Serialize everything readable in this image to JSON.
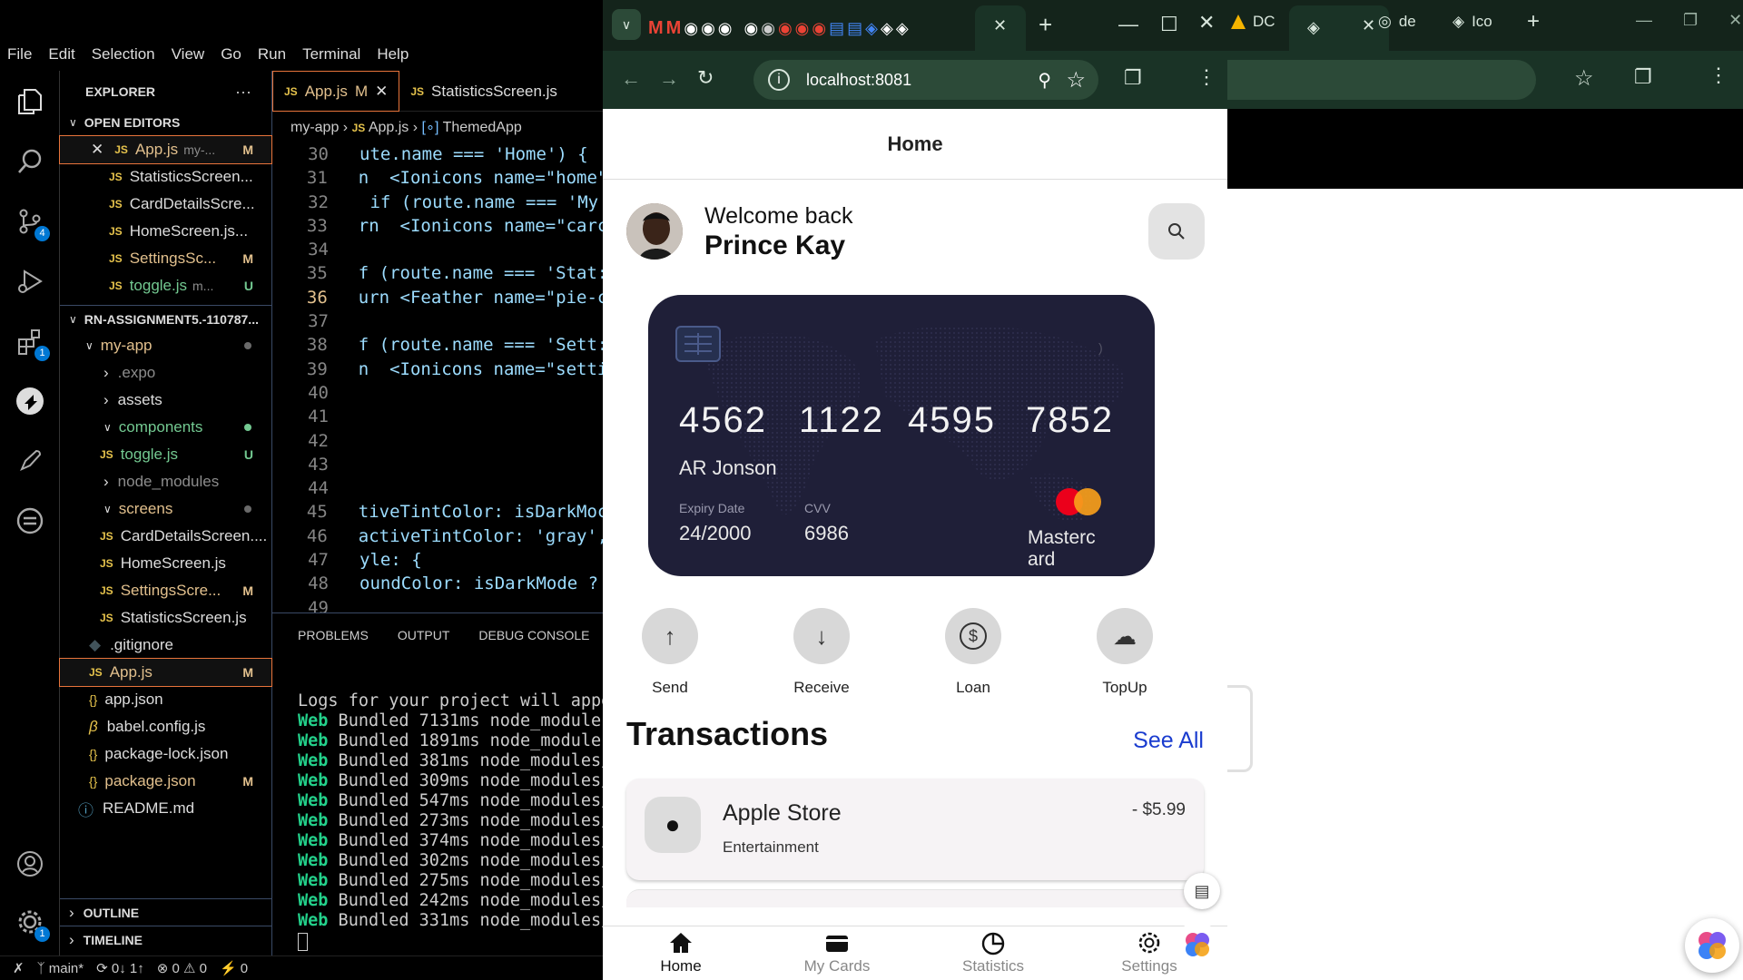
{
  "vscode": {
    "menu": [
      "File",
      "Edit",
      "Selection",
      "View",
      "Go",
      "Run",
      "Terminal",
      "Help"
    ],
    "explorer_title": "EXPLORER",
    "open_editors_title": "OPEN EDITORS",
    "open_editors": [
      {
        "name": "App.js",
        "desc": "my-...",
        "mark": "M"
      },
      {
        "name": "StatisticsScreen...",
        "mark": ""
      },
      {
        "name": "CardDetailsScre...",
        "mark": ""
      },
      {
        "name": "HomeScreen.js...",
        "mark": ""
      },
      {
        "name": "SettingsSc...",
        "mark": "M"
      },
      {
        "name": "toggle.js",
        "desc": "m...",
        "mark": "U"
      }
    ],
    "project_title": "RN-ASSIGNMENT5.-110787...",
    "tree": {
      "my_app": "my-app",
      "expo": ".expo",
      "assets": "assets",
      "components": "components",
      "toggle": "toggle.js",
      "toggle_mark": "U",
      "node_modules": "node_modules",
      "screens": "screens",
      "card_details": "CardDetailsScreen....",
      "home_screen": "HomeScreen.js",
      "settings_screen": "SettingsScre...",
      "settings_mark": "M",
      "statistics_screen": "StatisticsScreen.js",
      "gitignore": ".gitignore",
      "app_js": "App.js",
      "app_js_mark": "M",
      "app_json": "app.json",
      "babel": "babel.config.js",
      "package_lock": "package-lock.json",
      "package_json": "package.json",
      "package_json_mark": "M",
      "readme": "README.md"
    },
    "outline": "OUTLINE",
    "timeline": "TIMELINE",
    "tabs": [
      {
        "name": "App.js",
        "mark": "M"
      },
      {
        "name": "StatisticsScreen.js"
      }
    ],
    "breadcrumb": [
      "my-app",
      "App.js",
      "ThemedApp"
    ],
    "line_numbers": [
      "30",
      "31",
      "32",
      "33",
      "34",
      "35",
      "36",
      "37",
      "38",
      "39",
      "40",
      "41",
      "42",
      "43",
      "44",
      "45",
      "46",
      "47",
      "48",
      "49"
    ],
    "code_lines": [
      "ute.name === 'Home') {",
      "n  <Ionicons name=\"home\"",
      " if (route.name === 'My",
      "rn  <Ionicons name=\"carc",
      "",
      "f (route.name === 'Stat:",
      "urn <Feather name=\"pie-c",
      "",
      "f (route.name === 'Sett:",
      "n  <Ionicons name=\"setti",
      "",
      "",
      "",
      "",
      "",
      "tiveTintColor: isDarkMoc",
      "activeTintColor: 'gray',",
      "yle: {",
      "oundColor: isDarkMode ?",
      ""
    ],
    "panel_tabs": [
      "PROBLEMS",
      "OUTPUT",
      "DEBUG CONSOLE"
    ],
    "terminal_first": "Logs for your project will appe",
    "terminal_bundles": [
      {
        "label": "Web",
        "text": " Bundled 7131ms node_modules"
      },
      {
        "label": "Web",
        "text": " Bundled 1891ms node_modules"
      },
      {
        "label": "Web",
        "text": " Bundled 381ms node_modules/"
      },
      {
        "label": "Web",
        "text": " Bundled 309ms node_modules/"
      },
      {
        "label": "Web",
        "text": " Bundled 547ms node_modules/"
      },
      {
        "label": "Web",
        "text": " Bundled 273ms node_modules/"
      },
      {
        "label": "Web",
        "text": " Bundled 374ms node_modules/"
      },
      {
        "label": "Web",
        "text": " Bundled 302ms node_modules/"
      },
      {
        "label": "Web",
        "text": " Bundled 275ms node_modules/"
      },
      {
        "label": "Web",
        "text": " Bundled 242ms node_modules/"
      },
      {
        "label": "Web",
        "text": " Bundled 331ms node_modules/"
      }
    ],
    "status": {
      "branch": "main*",
      "sync": "0↓ 1↑",
      "problems": "⊗ 0 ⚠ 0",
      "ports": "⚡ 0"
    },
    "badges": {
      "scm": "4",
      "extensions": "1",
      "settings": "1"
    }
  },
  "browser": {
    "url": "localhost:8081",
    "bg_tabs": [
      "DC",
      "de",
      "Ico"
    ]
  },
  "app": {
    "header": "Home",
    "welcome": "Welcome back",
    "user_name": "Prince Kay",
    "card": {
      "number_groups": [
        "4562",
        "1122",
        "4595",
        "7852"
      ],
      "holder": "AR Jonson",
      "expiry_label": "Expiry Date",
      "expiry": "24/2000",
      "cvv_label": "CVV",
      "cvv": "6986",
      "brand_line1": "Masterc",
      "brand_line2": "ard"
    },
    "actions": [
      "Send",
      "Receive",
      "Loan",
      "TopUp"
    ],
    "transactions_title": "Transactions",
    "see_all": "See All",
    "transaction": {
      "name": "Apple Store",
      "category": "Entertainment",
      "amount": "- $5.99"
    },
    "nav": [
      "Home",
      "My Cards",
      "Statistics",
      "Settings"
    ]
  }
}
